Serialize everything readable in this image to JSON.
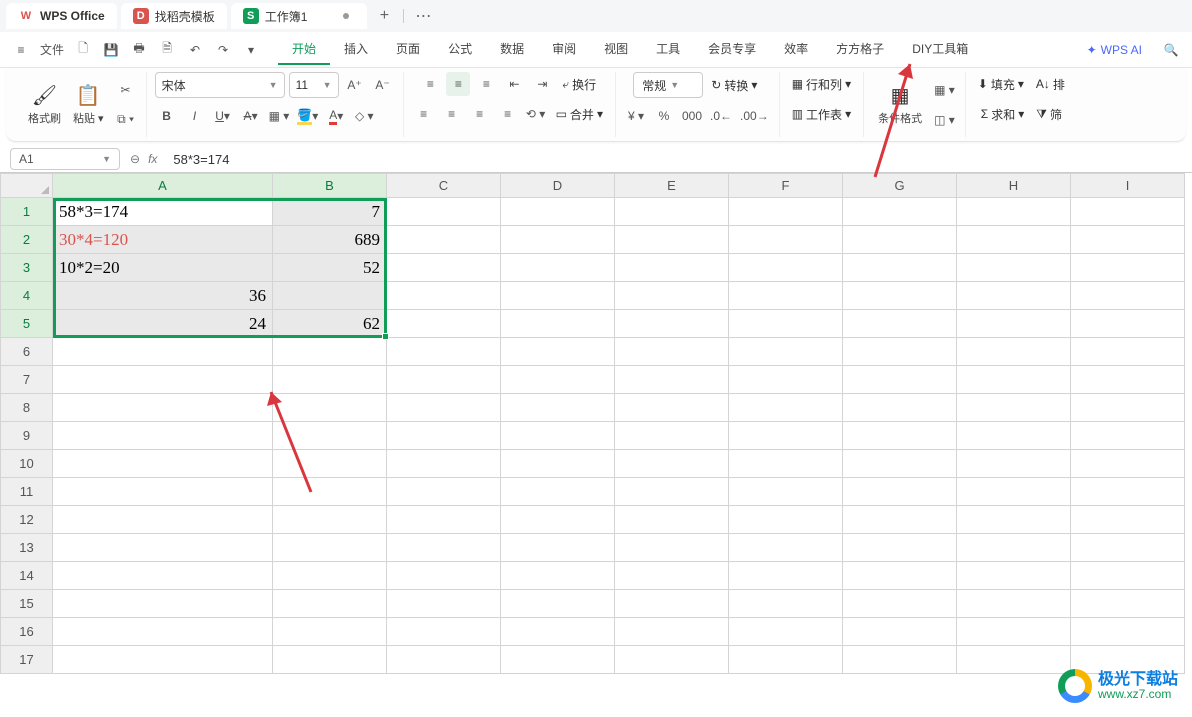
{
  "tabs": {
    "home": "WPS Office",
    "template": "找稻壳模板",
    "workbook": "工作簿1",
    "add": "+"
  },
  "menubar": {
    "file": "文件",
    "tabs": [
      "开始",
      "插入",
      "页面",
      "公式",
      "数据",
      "审阅",
      "视图",
      "工具",
      "会员专享",
      "效率",
      "方方格子",
      "DIY工具箱"
    ],
    "active_index": 0,
    "wps_ai": "WPS AI"
  },
  "ribbon": {
    "clipboard": {
      "format_painter": "格式刷",
      "paste": "粘贴"
    },
    "font": {
      "name": "宋体",
      "size": "11"
    },
    "align": {
      "wrap": "换行",
      "merge": "合并"
    },
    "number": {
      "format": "常规",
      "convert": "转换"
    },
    "cells": {
      "rowcol": "行和列",
      "worksheet": "工作表"
    },
    "styles": {
      "cond": "条件格式"
    },
    "editing": {
      "fill": "填充",
      "sum": "求和",
      "sort": "排",
      "filter": "筛"
    }
  },
  "namebox": "A1",
  "formula_bar": "58*3=174",
  "columns": [
    "A",
    "B",
    "C",
    "D",
    "E",
    "F",
    "G",
    "H",
    "I"
  ],
  "rows": [
    "1",
    "2",
    "3",
    "4",
    "5",
    "6",
    "7",
    "8",
    "9",
    "10",
    "11",
    "12",
    "13",
    "14",
    "15",
    "16",
    "17"
  ],
  "cells": {
    "A1": "58*3=174",
    "A2": "30*4=120",
    "A3": "10*2=20",
    "A4": "36",
    "A5": "24",
    "B1": "7",
    "B2": "689",
    "B3": "52",
    "B5": "62"
  },
  "watermark": {
    "title": "极光下载站",
    "url": "www.xz7.com"
  }
}
